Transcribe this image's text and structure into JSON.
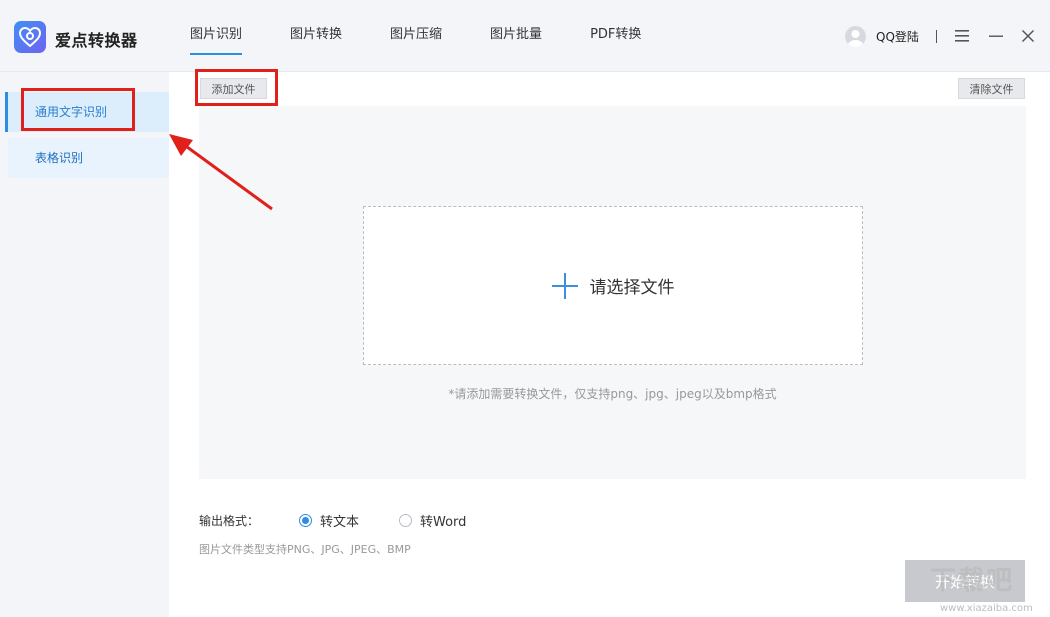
{
  "app": {
    "title": "爱点转换器"
  },
  "tabs": [
    {
      "label": "图片识别",
      "active": true
    },
    {
      "label": "图片转换",
      "active": false
    },
    {
      "label": "图片压缩",
      "active": false
    },
    {
      "label": "图片批量",
      "active": false
    },
    {
      "label": "PDF转换",
      "active": false
    }
  ],
  "header": {
    "login_label": "QQ登陆",
    "separator": "|"
  },
  "sidebar": {
    "items": [
      {
        "label": "通用文字识别",
        "active": true
      },
      {
        "label": "表格识别",
        "active": false
      }
    ]
  },
  "toolbar": {
    "add_file": "添加文件",
    "clear_file": "清除文件"
  },
  "drop": {
    "label": "请选择文件",
    "hint": "*请添加需要转换文件，仅支持png、jpg、jpeg以及bmp格式"
  },
  "output": {
    "label": "输出格式：",
    "options": [
      {
        "label": "转文本",
        "checked": true
      },
      {
        "label": "转Word",
        "checked": false
      }
    ],
    "support_note": "图片文件类型支持PNG、JPG、JPEG、BMP"
  },
  "start_button": {
    "label": "开始转换"
  },
  "watermark": {
    "text": "下载吧",
    "url": "www.xiazaiba.com"
  },
  "colors": {
    "accent": "#2e8de0",
    "annotation": "#e0201b",
    "disabled_button": "#c7c9ce"
  }
}
